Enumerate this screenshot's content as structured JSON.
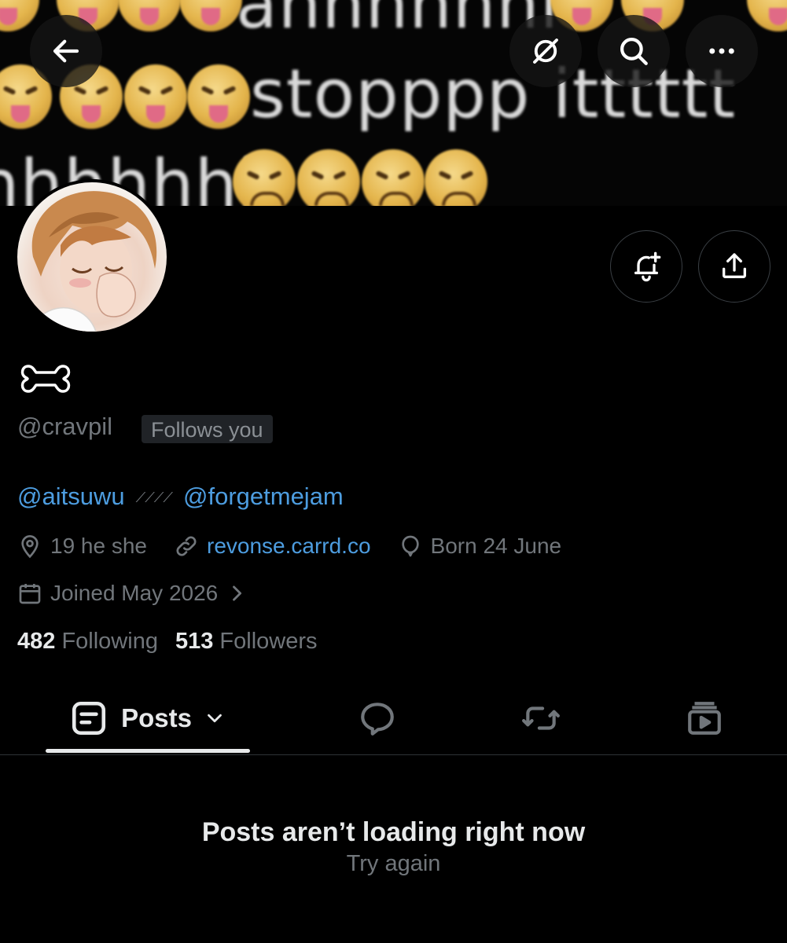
{
  "banner": {
    "line1": "ahhhhhhh",
    "line2": "stopppp itttttt",
    "line3": "hhhhhhh"
  },
  "profile": {
    "handle": "@cravpil",
    "follows_you": "Follows you",
    "bio": {
      "mention1": "@aitsuwu",
      "separator": "⟋⟋⟋⟋",
      "mention2": "@forgetmejam"
    },
    "location": "19 he she",
    "website": "revonse.carrd.co",
    "birthday": "Born 24 June",
    "joined": "Joined May 2026"
  },
  "stats": {
    "following_count": "482",
    "following_label": "Following",
    "followers_count": "513",
    "followers_label": "Followers"
  },
  "tabs": {
    "posts_label": "Posts"
  },
  "empty_state": {
    "title": "Posts aren’t loading right now",
    "action": "Try again"
  },
  "colors": {
    "background": "#000000",
    "link": "#4d9de0",
    "secondary_text": "#71767b",
    "primary_text": "#e7e9ea"
  },
  "icons": [
    "back-arrow-icon",
    "grok-icon",
    "search-icon",
    "more-icon",
    "notification-bell-plus-icon",
    "share-icon",
    "location-icon",
    "link-icon",
    "balloon-icon",
    "calendar-icon",
    "chevron-right-icon",
    "posts-icon",
    "chevron-down-icon",
    "replies-icon",
    "reposts-icon",
    "media-icon"
  ]
}
